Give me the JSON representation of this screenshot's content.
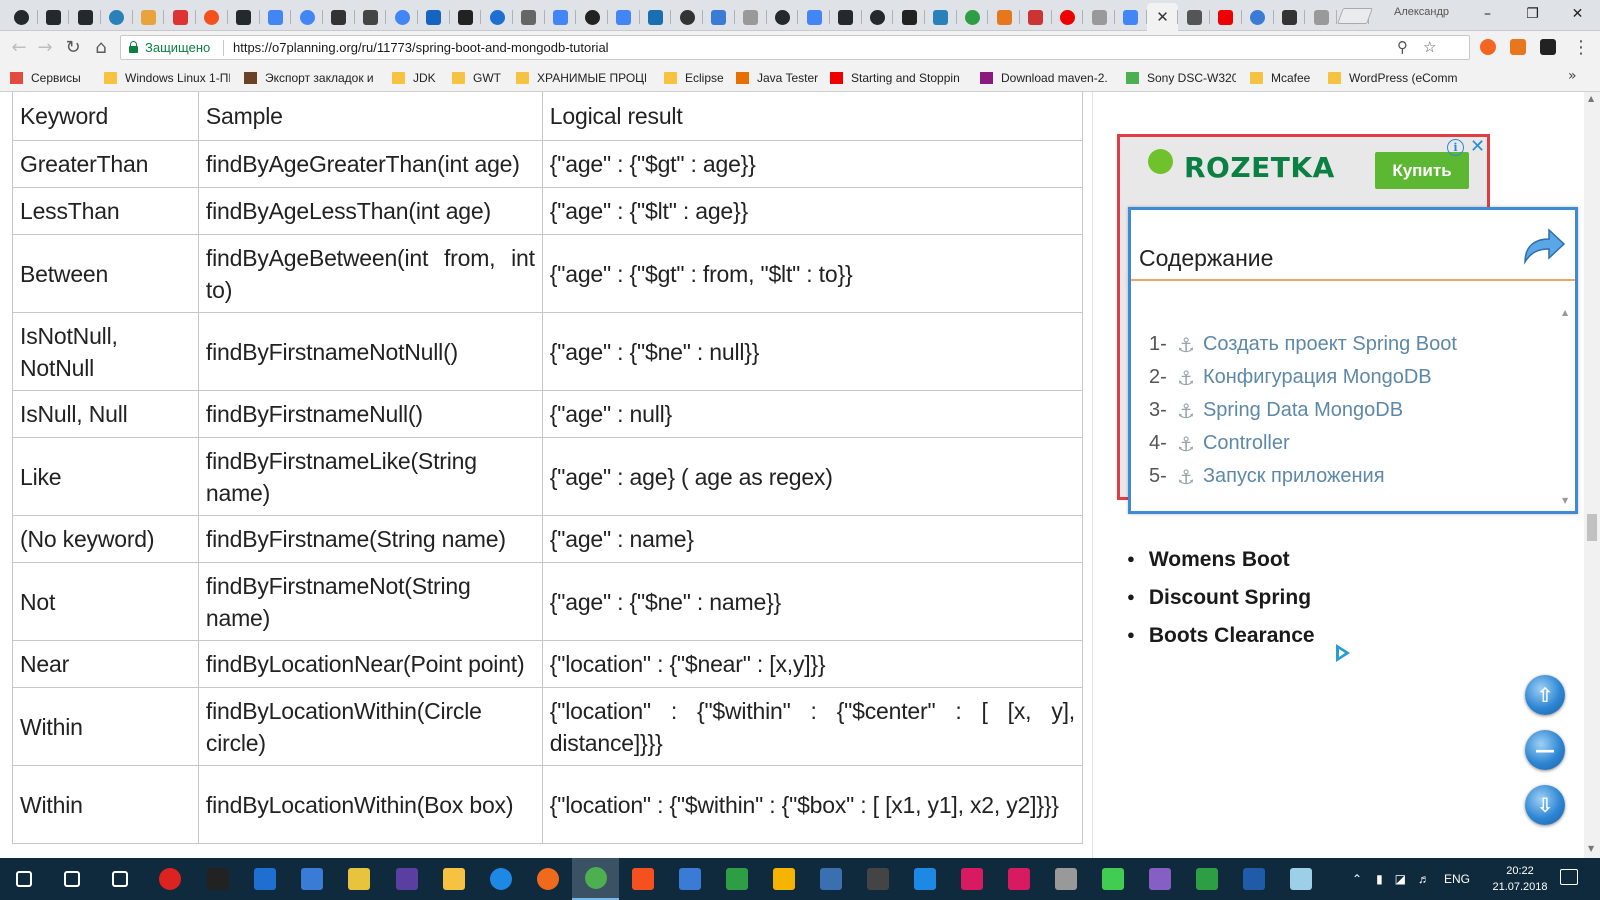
{
  "browser": {
    "tabs_count": 43,
    "active_tab_index": 36,
    "profile_name": "Александр",
    "security_label": "Защищено",
    "url": "https://o7planning.org/ru/11773/spring-boot-and-mongodb-tutorial",
    "bookmarks": [
      {
        "label": "Сервисы",
        "icon": "apps-grid-icon"
      },
      {
        "label": "Windows Linux 1-ПК",
        "icon": "folder-icon"
      },
      {
        "label": "Экспорт закладок и",
        "icon": "bookmark-export-icon"
      },
      {
        "label": "JDK",
        "icon": "folder-icon"
      },
      {
        "label": "GWT",
        "icon": "folder-icon"
      },
      {
        "label": "ХРАНИМЫЕ ПРОЦЕ",
        "icon": "folder-icon"
      },
      {
        "label": "Eclipse",
        "icon": "folder-icon"
      },
      {
        "label": "Java Tester",
        "icon": "java-icon"
      },
      {
        "label": "Starting and Stoppin",
        "icon": "oracle-icon"
      },
      {
        "label": "Download maven-2.",
        "icon": "maven-feather-icon"
      },
      {
        "label": "Sony DSC-W320",
        "icon": "sony-icon"
      },
      {
        "label": "Mcafee",
        "icon": "folder-icon"
      },
      {
        "label": "WordPress (eComm",
        "icon": "folder-icon"
      }
    ]
  },
  "table": {
    "headers": [
      "Keyword",
      "Sample",
      "Logical result"
    ],
    "rows": [
      [
        "GreaterThan",
        "findByAgeGreaterThan(int age)",
        "{\"age\" : {\"$gt\" : age}}"
      ],
      [
        "LessThan",
        "findByAgeLessThan(int age)",
        "{\"age\" : {\"$lt\" : age}}"
      ],
      [
        "Between",
        "findByAgeBetween(int from, int to)",
        "{\"age\" : {\"$gt\" : from, \"$lt\" : to}}"
      ],
      [
        "IsNotNull, NotNull",
        "findByFirstnameNotNull()",
        "{\"age\" : {\"$ne\" : null}}"
      ],
      [
        "IsNull, Null",
        "findByFirstnameNull()",
        "{\"age\" : null}"
      ],
      [
        "Like",
        "findByFirstnameLike(String name)",
        "{\"age\" : age} ( age as regex)"
      ],
      [
        "(No keyword)",
        "findByFirstname(String name)",
        "{\"age\" : name}"
      ],
      [
        "Not",
        "findByFirstnameNot(String name)",
        "{\"age\" : {\"$ne\" : name}}"
      ],
      [
        "Near",
        "findByLocationNear(Point point)",
        "{\"location\" : {\"$near\" : [x,y]}}"
      ],
      [
        "Within",
        "findByLocationWithin(Circle circle)",
        "{\"location\" : {\"$within\" : {\"$center\" : [ [x, y], distance]}}}"
      ],
      [
        "Within",
        "findByLocationWithin(Box box)",
        "{\"location\" : {\"$within\" : {\"$box\" : [ [x1, y1], x2, y2]}}}"
      ]
    ]
  },
  "ad": {
    "brand": "ROZETKA",
    "cta": "Купить",
    "info": "i",
    "close": "✕"
  },
  "toc": {
    "title": "Содержание",
    "items": [
      {
        "num": "1-",
        "label": "Создать проект Spring Boot"
      },
      {
        "num": "2-",
        "label": "Конфигурация MongoDB"
      },
      {
        "num": "3-",
        "label": "Spring Data MongoDB"
      },
      {
        "num": "4-",
        "label": "Controller"
      },
      {
        "num": "5-",
        "label": "Запуск приложения"
      }
    ]
  },
  "ad_links": [
    "Womens Boot",
    "Discount Spring",
    "Boots Clearance"
  ],
  "taskbar": {
    "language": "ENG",
    "time": "20:22",
    "date": "21.07.2018"
  },
  "colors": {
    "secure_green": "#0b8043",
    "toc_border": "#3d8bd4",
    "toc_link": "#5d88a8",
    "ad_border": "#e23c45",
    "taskbar_bg": "#0f2a3d"
  }
}
